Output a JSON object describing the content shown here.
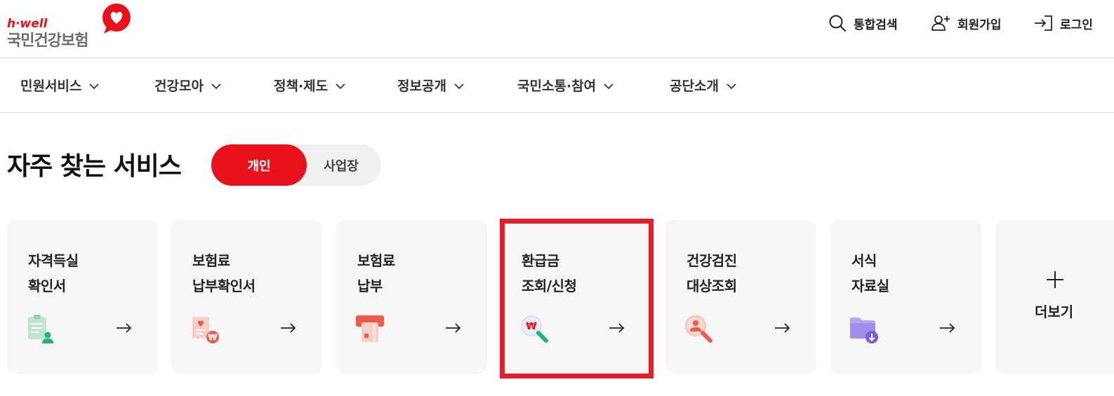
{
  "header": {
    "logo_brand": "h·well",
    "logo_name": "국민건강보험",
    "search_label": "통합검색",
    "join_label": "회원가입",
    "login_label": "로그인"
  },
  "gnb": {
    "items": [
      {
        "label": "민원서비스"
      },
      {
        "label": "건강모아"
      },
      {
        "label": "정책·제도"
      },
      {
        "label": "정보공개"
      },
      {
        "label": "국민소통·참여"
      },
      {
        "label": "공단소개"
      }
    ]
  },
  "section": {
    "title": "자주 찾는 서비스",
    "toggle_active": "개인",
    "toggle_inactive": "사업장"
  },
  "cards": [
    {
      "line1": "자격득실",
      "line2": "확인서",
      "icon": "certificate-person-icon"
    },
    {
      "line1": "보험료",
      "line2": "납부확인서",
      "icon": "receipt-won-icon"
    },
    {
      "line1": "보험료",
      "line2": "납부",
      "icon": "card-payment-icon"
    },
    {
      "line1": "환급금",
      "line2": "조회/신청",
      "icon": "refund-search-icon"
    },
    {
      "line1": "건강검진",
      "line2": "대상조회",
      "icon": "person-search-icon"
    },
    {
      "line1": "서식",
      "line2": "자료실",
      "icon": "folder-download-icon"
    }
  ],
  "more": {
    "label": "더보기"
  },
  "colors": {
    "brand_red": "#e8111b",
    "highlight_red": "#e41e2b",
    "card_bg": "#f6f6f6",
    "toggle_bg": "#efefef"
  }
}
